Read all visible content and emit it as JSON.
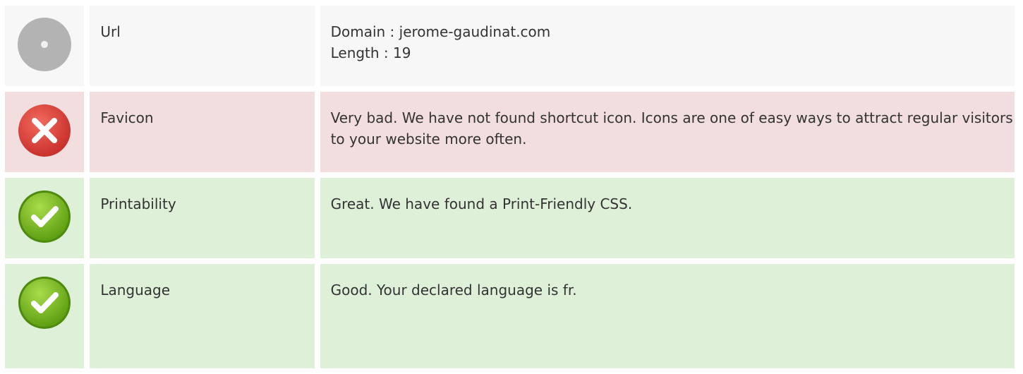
{
  "rows": [
    {
      "status": "neutral",
      "icon": "neutral-disc-icon",
      "label": "Url",
      "lines": [
        "Domain : jerome-gaudinat.com",
        "Length : 19"
      ]
    },
    {
      "status": "bad",
      "icon": "error-x-icon",
      "label": "Favicon",
      "lines": [
        "Very bad. We have not found shortcut icon. Icons are one of easy ways to attract regular visitors to your website more often."
      ]
    },
    {
      "status": "good",
      "icon": "success-check-icon",
      "label": "Printability",
      "lines": [
        "Great. We have found a Print-Friendly CSS."
      ]
    },
    {
      "status": "good",
      "icon": "success-check-icon",
      "label": "Language",
      "lines": [
        "Good. Your declared language is fr."
      ]
    }
  ],
  "colors": {
    "neutral_bg": "#f7f7f7",
    "bad_bg": "#f2dede",
    "good_bg": "#dff0d8",
    "error_icon": "#e0403b",
    "success_icon": "#7cbf21",
    "neutral_icon": "#b3b3b3"
  }
}
